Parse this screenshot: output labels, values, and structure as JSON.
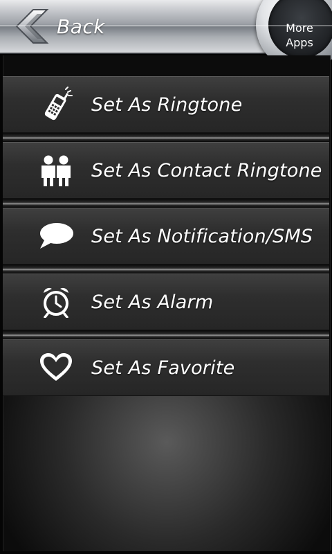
{
  "header": {
    "back_label": "Back",
    "more_apps_line1": "More",
    "more_apps_line2": "Apps"
  },
  "menu": {
    "items": [
      {
        "label": "Set As Ringtone",
        "icon": "phone-icon"
      },
      {
        "label": "Set As Contact Ringtone",
        "icon": "contacts-icon"
      },
      {
        "label": "Set As Notification/SMS",
        "icon": "speech-bubble-icon"
      },
      {
        "label": "Set As Alarm",
        "icon": "alarm-clock-icon"
      },
      {
        "label": "Set As Favorite",
        "icon": "heart-icon"
      }
    ]
  },
  "colors": {
    "text": "#ffffff",
    "menu_bg": "#2e2e2e",
    "header_silver": "#c9cbcf"
  }
}
